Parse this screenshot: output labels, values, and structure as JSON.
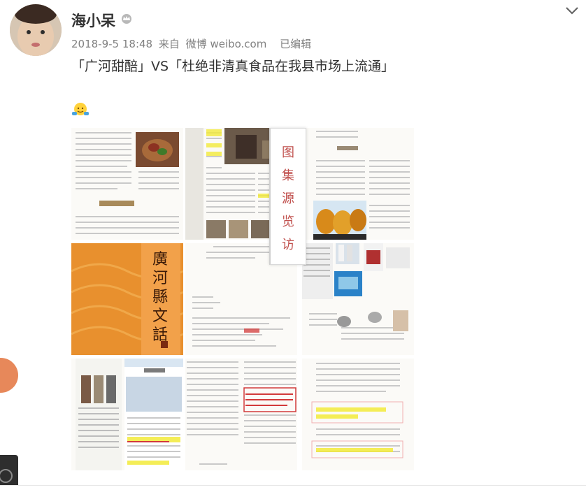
{
  "post": {
    "username": "海小呆",
    "date": "2018-9-5 18:48",
    "source_prefix": "来自",
    "source": "微博 weibo.com",
    "edited": "已编辑",
    "text": "「广河甜醅」VS「杜绝非清真食品在我县市场上流通」"
  },
  "viewer": {
    "chars": [
      "图",
      "集",
      "源",
      "览",
      "访"
    ]
  },
  "book_cover": {
    "title_chars": [
      "廣",
      "河",
      "縣",
      "文",
      "話"
    ]
  },
  "icons": {
    "crown": "crown-icon",
    "chevron": "chevron-down-icon",
    "emoji": "shrug-emoji-icon"
  },
  "colors": {
    "accent_orange": "#e8902e",
    "viewer_text": "#c0504d",
    "highlight_yellow": "#f2ea3a",
    "highlight_red": "#d23a3a"
  }
}
